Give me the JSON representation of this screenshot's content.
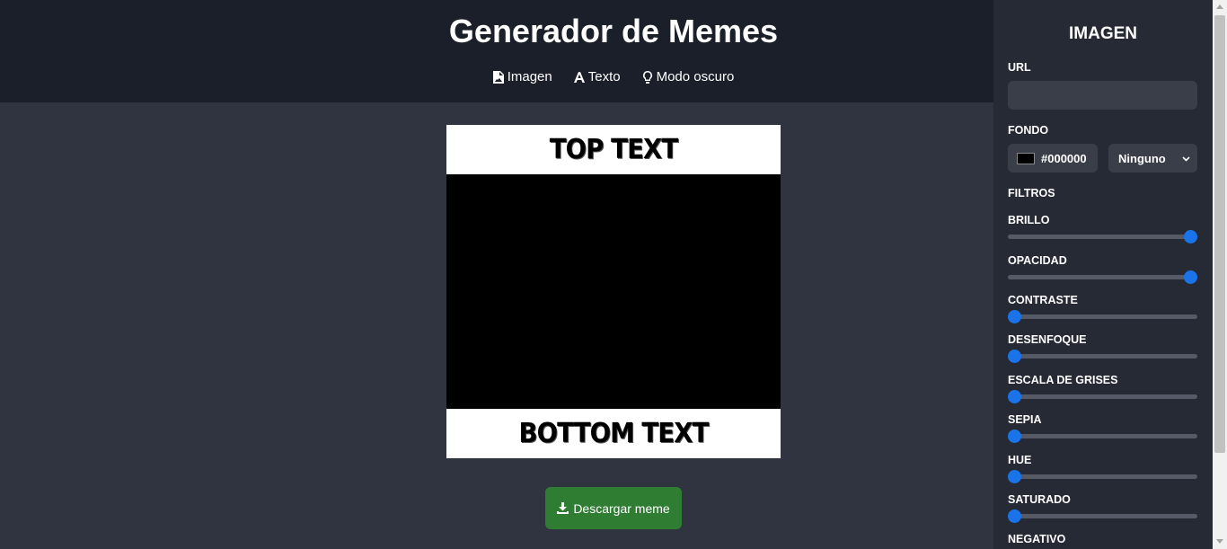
{
  "header": {
    "title": "Generador de Memes",
    "nav": [
      {
        "label": "Imagen",
        "icon": "image-file-icon"
      },
      {
        "label": "Texto",
        "icon": "font-icon"
      },
      {
        "label": "Modo oscuro",
        "icon": "lightbulb-icon"
      }
    ]
  },
  "meme": {
    "top_text": "TOP TEXT",
    "bottom_text": "BOTTOM TEXT",
    "background_color": "#000000"
  },
  "download_label": "Descargar meme",
  "panel": {
    "title": "IMAGEN",
    "url_label": "URL",
    "url_value": "",
    "fondo_label": "FONDO",
    "color_value": "#000000",
    "blend_selected": "Ninguno",
    "filtros_label": "FILTROS",
    "sliders": [
      {
        "label": "BRILLO",
        "value": 1
      },
      {
        "label": "OPACIDAD",
        "value": 1
      },
      {
        "label": "CONTRASTE",
        "value": 0
      },
      {
        "label": "DESENFOQUE",
        "value": 0
      },
      {
        "label": "ESCALA DE GRISES",
        "value": 0
      },
      {
        "label": "SEPIA",
        "value": 0
      },
      {
        "label": "HUE",
        "value": 0
      },
      {
        "label": "SATURADO",
        "value": 0
      }
    ],
    "last_label": "NEGATIVO"
  },
  "colors": {
    "accent": "#1a73e8",
    "download": "#2e7d32",
    "header_bg": "#1a1f29",
    "panel_bg": "#262a35",
    "main_bg": "#303440"
  }
}
